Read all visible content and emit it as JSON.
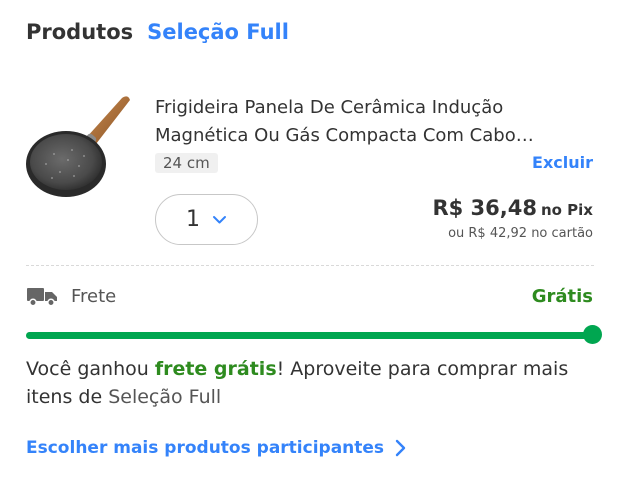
{
  "header": {
    "title": "Produtos",
    "subtitle": "Seleção Full"
  },
  "product": {
    "name": "Frigideira Panela De Cerâmica Indução Magnética Ou Gás Compacta Com Cabo…",
    "variant": "24 cm",
    "remove_label": "Excluir",
    "image_icon": "frying-pan",
    "quantity": "1",
    "price": "R$ 36,48",
    "price_method": "no Pix",
    "alt_price": "ou R$ 42,92 no cartão"
  },
  "shipping": {
    "label": "Frete",
    "value": "Grátis",
    "progress_fraction": 1.0,
    "message_prefix": "Você ganhou ",
    "message_highlight": "frete grátis",
    "message_middle": "! Aproveite para comprar mais itens de ",
    "message_brand": "Seleção Full",
    "more_link": "Escolher mais produtos participantes"
  },
  "colors": {
    "accent": "#3483fa",
    "success": "#00a650",
    "success_text": "#2e8b1f",
    "text": "#333333"
  }
}
